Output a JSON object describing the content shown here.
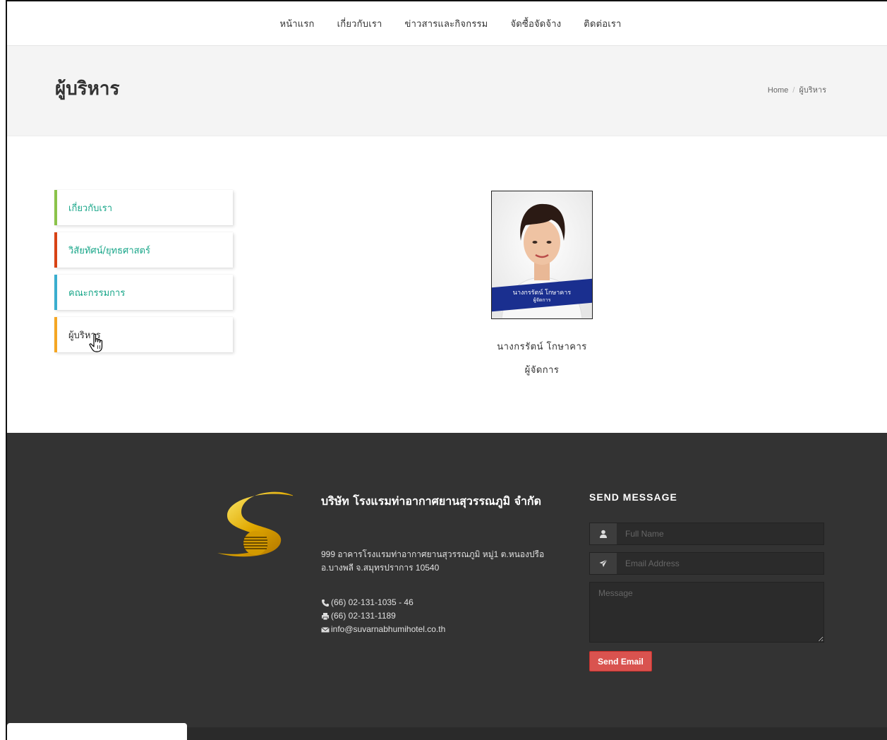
{
  "nav": {
    "items": [
      "หน้าแรก",
      "เกี่ยวกับเรา",
      "ข่าวสารและกิจกรรม",
      "จัดซื้อจัดจ้าง",
      "ติดต่อเรา"
    ]
  },
  "header": {
    "title": "ผู้บริหาร",
    "breadcrumb": {
      "home": "Home",
      "separator": "/",
      "current": "ผู้บริหาร"
    }
  },
  "sidebar": {
    "items": [
      {
        "label": "เกี่ยวกับเรา",
        "accent": "#8bc34a"
      },
      {
        "label": "วิสัยทัศน์/ยุทธศาสตร์",
        "accent": "#d84315"
      },
      {
        "label": "คณะกรรมการ",
        "accent": "#3aaecf"
      },
      {
        "label": "ผู้บริหาร",
        "accent": "#f5a623",
        "active": true
      }
    ]
  },
  "executive": {
    "photo_overlay_name": "นางกรรัตน์ โกษาคาร",
    "photo_overlay_title": "ผู้จัดการ",
    "name": "นางกรรัตน์  โกษาคาร",
    "position": "ผู้จัดการ"
  },
  "footer": {
    "company_name": "บริษัท โรงแรมท่าอากาศยานสุวรรณภูมิ จำกัด",
    "address": "999 อาคารโรงแรมท่าอากาศยานสุวรรณภูมิ หมู่1 ต.หนองปรือ อ.บางพลี จ.สมุทรปราการ 10540",
    "phone": "(66) 02-131-1035 - 46",
    "fax": "(66) 02-131-1189",
    "email": "info@suvarnabhumihotel.co.th",
    "form": {
      "title": "SEND MESSAGE",
      "name_placeholder": "Full Name",
      "email_placeholder": "Email Address",
      "message_placeholder": "Message",
      "submit_label": "Send Email"
    }
  },
  "colors": {
    "accent_green": "#18a689",
    "footer_bg": "#333333",
    "button_red": "#d9534f"
  },
  "icons": [
    "user-icon",
    "paper-plane-icon",
    "phone-icon",
    "print-icon",
    "envelope-icon",
    "hand-pointer-icon"
  ]
}
